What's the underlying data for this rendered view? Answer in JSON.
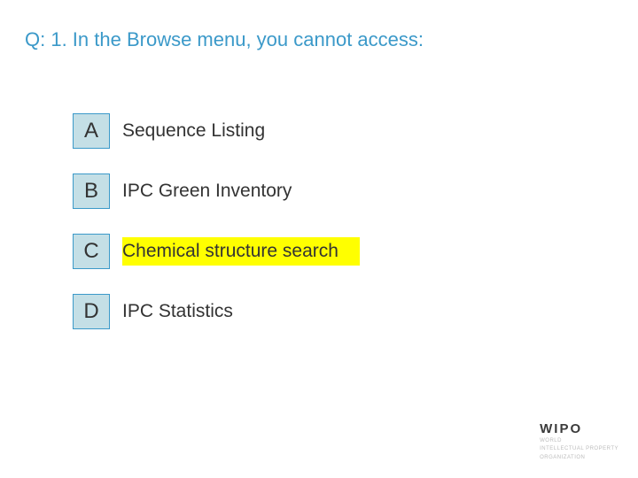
{
  "question": "Q: 1. In the Browse menu, you cannot access:",
  "options": [
    {
      "letter": "A",
      "text": "Sequence Listing",
      "highlight": false
    },
    {
      "letter": "B",
      "text": "IPC Green Inventory",
      "highlight": false
    },
    {
      "letter": "C",
      "text": "Chemical structure search",
      "highlight": true
    },
    {
      "letter": "D",
      "text": "IPC Statistics",
      "highlight": false
    }
  ],
  "logo": {
    "brand": "WIPO",
    "line1": "WORLD",
    "line2": "INTELLECTUAL PROPERTY",
    "line3": "ORGANIZATION"
  }
}
